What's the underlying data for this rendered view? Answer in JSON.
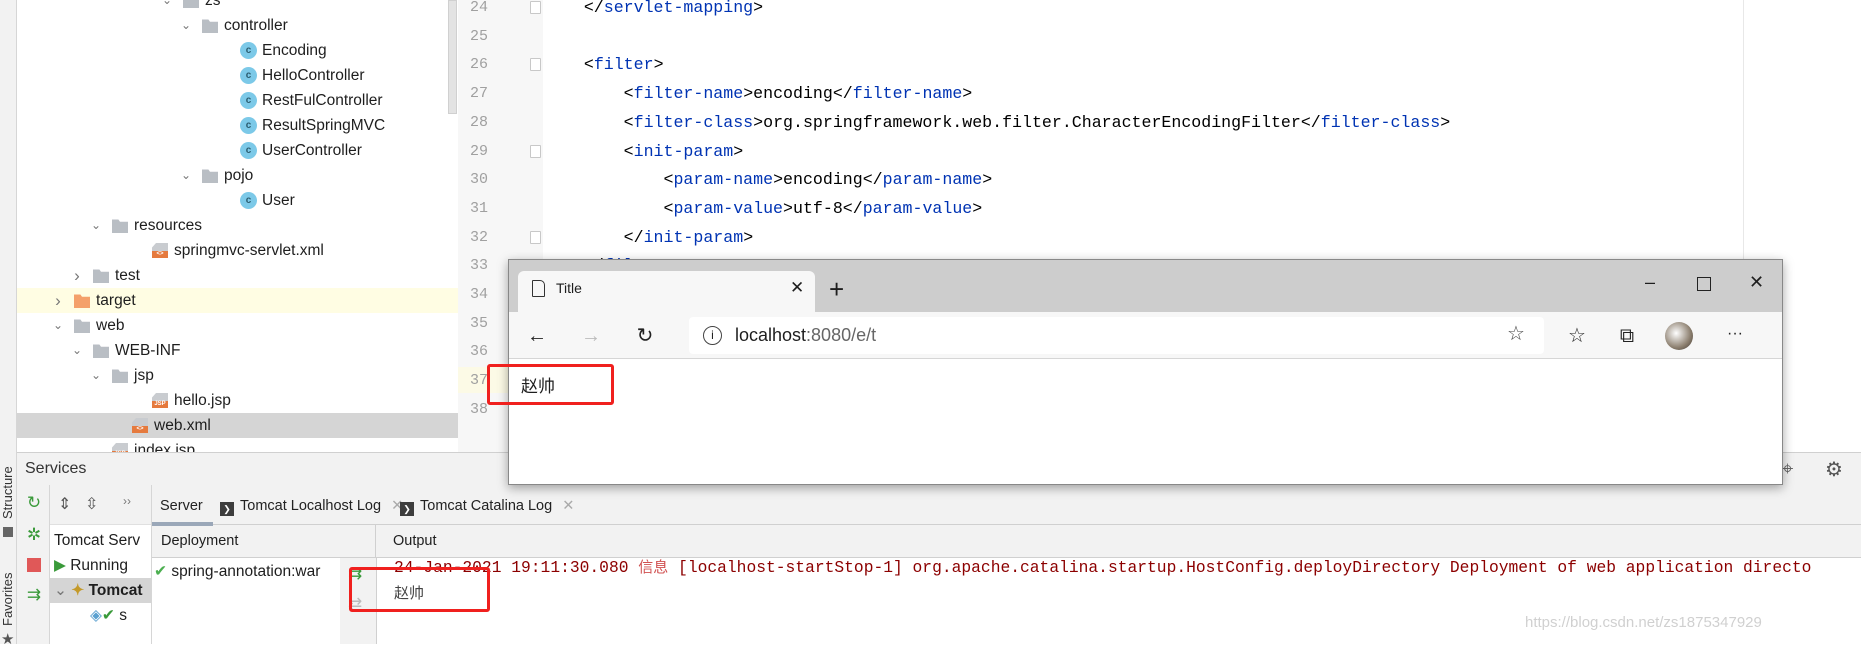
{
  "sidebar_strip": {
    "structure_label": "Structure",
    "favorites_label": "Favorites"
  },
  "project_tree": [
    {
      "label": "zs",
      "icon": "folder-icon",
      "expanded": true
    },
    {
      "label": "controller",
      "icon": "folder-icon",
      "expanded": true
    },
    {
      "label": "Encoding",
      "icon": "class-icon"
    },
    {
      "label": "HelloController",
      "icon": "class-icon"
    },
    {
      "label": "RestFulController",
      "icon": "class-icon"
    },
    {
      "label": "ResultSpringMVC",
      "icon": "class-icon"
    },
    {
      "label": "UserController",
      "icon": "class-icon"
    },
    {
      "label": "pojo",
      "icon": "folder-icon",
      "expanded": true
    },
    {
      "label": "User",
      "icon": "class-icon"
    },
    {
      "label": "resources",
      "icon": "resources-folder-icon",
      "expanded": true
    },
    {
      "label": "springmvc-servlet.xml",
      "icon": "spring-xml-file-icon"
    },
    {
      "label": "test",
      "icon": "folder-icon",
      "expanded": false
    },
    {
      "label": "target",
      "icon": "excluded-folder-icon",
      "expanded": false,
      "highlighted": true
    },
    {
      "label": "web",
      "icon": "web-folder-icon",
      "expanded": true
    },
    {
      "label": "WEB-INF",
      "icon": "folder-icon",
      "expanded": true
    },
    {
      "label": "jsp",
      "icon": "folder-icon",
      "expanded": true
    },
    {
      "label": "hello.jsp",
      "icon": "jsp-file-icon"
    },
    {
      "label": "web.xml",
      "icon": "xml-file-icon",
      "selected": true
    },
    {
      "label": "index.jsp",
      "icon": "jsp-file-icon"
    }
  ],
  "editor": {
    "lines": [
      {
        "n": "24",
        "code": "    </servlet-mapping>"
      },
      {
        "n": "25",
        "code": ""
      },
      {
        "n": "26",
        "code": "    <filter>"
      },
      {
        "n": "27",
        "code": "        <filter-name>encoding</filter-name>"
      },
      {
        "n": "28",
        "code": "        <filter-class>org.springframework.web.filter.CharacterEncodingFilter</filter-class>"
      },
      {
        "n": "29",
        "code": "        <init-param>"
      },
      {
        "n": "30",
        "code": "            <param-name>encoding</param-name>"
      },
      {
        "n": "31",
        "code": "            <param-value>utf-8</param-value>"
      },
      {
        "n": "32",
        "code": "        </init-param>"
      },
      {
        "n": "33",
        "code": "    </filter>"
      },
      {
        "n": "34",
        "code": ""
      },
      {
        "n": "35",
        "code": ""
      },
      {
        "n": "36",
        "code": ""
      },
      {
        "n": "37",
        "code": ""
      },
      {
        "n": "38",
        "code": ""
      }
    ],
    "current_line": "37"
  },
  "services": {
    "title": "Services",
    "tree": [
      "Tomcat Serv",
      "Running",
      "Tomcat",
      "s"
    ],
    "tabs": [
      {
        "label": "Server",
        "active": true
      },
      {
        "label": "Tomcat Localhost Log",
        "closable": true
      },
      {
        "label": "Tomcat Catalina Log",
        "closable": true
      }
    ],
    "deployment_header": "Deployment",
    "output_header": "Output",
    "deployment_item": "spring-annotation:war",
    "output_lines": [
      {
        "prefix": "24-Jan-2021 19:11:30.080 ",
        "level": "信息",
        "rest": " [localhost-startStop-1] org.apache.catalina.startup.HostConfig.deployDirectory Deployment of web application directo"
      },
      {
        "prefix": "赵帅",
        "level": "",
        "rest": ""
      }
    ]
  },
  "browser": {
    "tab_title": "Title",
    "url_host": "localhost",
    "url_rest": ":8080/e/t",
    "page_text": "赵帅"
  },
  "watermark": "https://blog.csdn.net/zs1875347929",
  "colors": {
    "highlight_box": "#f0201e",
    "xml_tag": "#0033b3",
    "log_text": "#8c0000",
    "log_level": "#d05050"
  }
}
